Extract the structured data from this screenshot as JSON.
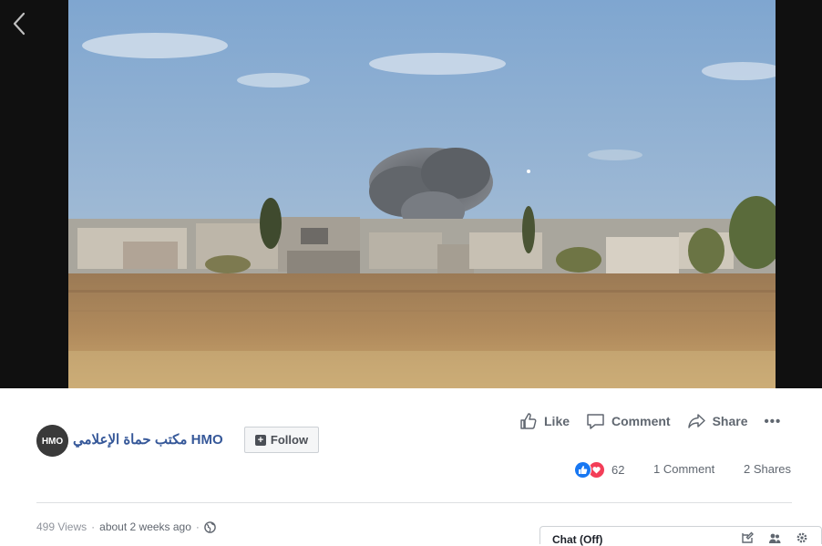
{
  "page": {
    "name": "مكتب حماة الإعلامي HMO",
    "avatar_text": "HMO",
    "follow_label": "Follow"
  },
  "actions": {
    "like": "Like",
    "comment": "Comment",
    "share": "Share"
  },
  "engagement": {
    "reactions_count": "62",
    "comments": "1 Comment",
    "shares": "2 Shares"
  },
  "meta": {
    "views": "499 Views",
    "separator": "·",
    "time": "about 2 weeks ago"
  },
  "chat": {
    "label": "Chat (Off)"
  },
  "icons": {
    "back": "chevron-left-icon",
    "like": "thumbs-up-icon",
    "comment": "speech-bubble-icon",
    "share": "share-arrow-icon",
    "more": "more-dots-icon",
    "globe": "globe-icon",
    "plus": "plus-icon"
  },
  "colors": {
    "link_blue": "#365899",
    "like_blue": "#1877f2",
    "love_red": "#f33e58",
    "muted": "#606770"
  }
}
